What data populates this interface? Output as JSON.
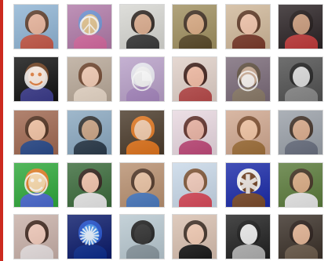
{
  "colors": {
    "accent_rule": "#cc2a1f"
  },
  "grid": {
    "rows": 5,
    "cols": 6,
    "avatars": [
      {
        "name": "avatar-woman-sunglasses-red",
        "bg": "#8fb4d4",
        "skin": "#e8b39a",
        "hair": "#5a3a28",
        "shirt": "#c65a4a",
        "icon": ""
      },
      {
        "name": "avatar-peace-sign-art",
        "bg": "#b07aa8",
        "skin": "#e0c08a",
        "hair": "#6a8fd0",
        "shirt": "#d46aa0",
        "icon": "☮"
      },
      {
        "name": "avatar-woman-sunglasses",
        "bg": "#d7d7d2",
        "skin": "#d9a98a",
        "hair": "#2a211c",
        "shirt": "#3a3a3a",
        "icon": ""
      },
      {
        "name": "avatar-smiling-man",
        "bg": "#a09060",
        "skin": "#d8a880",
        "hair": "#3b2a1c",
        "shirt": "#5a4a2a",
        "icon": ""
      },
      {
        "name": "avatar-smiling-girl",
        "bg": "#d0b89a",
        "skin": "#f0c2a8",
        "hair": "#5a3420",
        "shirt": "#7a3a2a",
        "icon": ""
      },
      {
        "name": "avatar-group-photo",
        "bg": "#2a2224",
        "skin": "#c89878",
        "hair": "#181010",
        "shirt": "#c03a3a",
        "icon": ""
      },
      {
        "name": "avatar-orange-robot-cartoon",
        "bg": "#111111",
        "skin": "#e07a3a",
        "hair": "#6a3a1a",
        "shirt": "#3a3a8a",
        "icon": "☻"
      },
      {
        "name": "avatar-woman-with-baby",
        "bg": "#b8a898",
        "skin": "#f0c8b0",
        "hair": "#6a4028",
        "shirt": "#e8d8c8",
        "icon": ""
      },
      {
        "name": "avatar-white-creature",
        "bg": "#b8a0c8",
        "skin": "#f4f4f4",
        "hair": "#e8e8f0",
        "shirt": "#a888c0",
        "icon": "◔"
      },
      {
        "name": "avatar-dark-hair-woman",
        "bg": "#e0d0c8",
        "skin": "#f0b8a0",
        "hair": "#3a1a14",
        "shirt": "#b84a4a",
        "icon": ""
      },
      {
        "name": "avatar-owl-close-up",
        "bg": "#7a6a78",
        "skin": "#c8a890",
        "hair": "#5a4a3a",
        "shirt": "#8a7a68",
        "icon": "◉"
      },
      {
        "name": "avatar-black-white-woman",
        "bg": "#505050",
        "skin": "#d8d8d8",
        "hair": "#1a1a1a",
        "shirt": "#888888",
        "icon": ""
      },
      {
        "name": "avatar-girl-lying-sideways",
        "bg": "#a06850",
        "skin": "#f0c0a0",
        "hair": "#4a2a18",
        "shirt": "#2a4a8a",
        "icon": ""
      },
      {
        "name": "avatar-man-by-lake",
        "bg": "#8aa8c0",
        "skin": "#c8a080",
        "hair": "#2a2a2a",
        "shirt": "#2a3a4a",
        "icon": ""
      },
      {
        "name": "avatar-orange-hood",
        "bg": "#4a3a2a",
        "skin": "#f0c8a8",
        "hair": "#e0741c",
        "shirt": "#e0741c",
        "icon": ""
      },
      {
        "name": "avatar-girl-selfie-pink",
        "bg": "#e8d8e0",
        "skin": "#e8b0a0",
        "hair": "#5a2a24",
        "shirt": "#c04a7a",
        "icon": ""
      },
      {
        "name": "avatar-smiling-brunette",
        "bg": "#d0a890",
        "skin": "#f0c2a0",
        "hair": "#7a4a2a",
        "shirt": "#a0703a",
        "icon": ""
      },
      {
        "name": "avatar-two-men",
        "bg": "#9aa0a8",
        "skin": "#d8a888",
        "hair": "#3a2a20",
        "shirt": "#6a7080",
        "icon": ""
      },
      {
        "name": "avatar-green-cartoon-girl",
        "bg": "#2ea83a",
        "skin": "#f8d8a8",
        "hair": "#e07a20",
        "shirt": "#4a6ad0",
        "icon": "☺"
      },
      {
        "name": "avatar-woman-green-background",
        "bg": "#3a6a3a",
        "skin": "#f0c0a8",
        "hair": "#2a1a14",
        "shirt": "#e8e8e8",
        "icon": ""
      },
      {
        "name": "avatar-child-on-stairs",
        "bg": "#b89070",
        "skin": "#e8c0a0",
        "hair": "#4a3020",
        "shirt": "#4a7ac0",
        "icon": ""
      },
      {
        "name": "avatar-girl-with-hat",
        "bg": "#c8d8e8",
        "skin": "#f0c8b8",
        "hair": "#7a5030",
        "shirt": "#d84a5a",
        "icon": ""
      },
      {
        "name": "avatar-pixel-character-blue",
        "bg": "#1a2aa8",
        "skin": "#6a3a1a",
        "hair": "#f0f0f0",
        "shirt": "#7a4a2a",
        "icon": "✱"
      },
      {
        "name": "avatar-man-sunglasses-green",
        "bg": "#5a7a3a",
        "skin": "#d8a880",
        "hair": "#3a2a1a",
        "shirt": "#e8e8e8",
        "icon": ""
      },
      {
        "name": "avatar-two-girls",
        "bg": "#c8b0a8",
        "skin": "#f0c8b8",
        "hair": "#3a2218",
        "shirt": "#e8e0e0",
        "icon": ""
      },
      {
        "name": "avatar-blue-spiral",
        "bg": "#0a1a6a",
        "skin": "#3a8ae8",
        "hair": "#1a4ac8",
        "shirt": "#0a2a8a",
        "icon": "✺"
      },
      {
        "name": "avatar-person-on-beach",
        "bg": "#b8c8d0",
        "skin": "#2a2a2a",
        "hair": "#1a1a1a",
        "shirt": "#8a98a0",
        "icon": ""
      },
      {
        "name": "avatar-big-sunglasses",
        "bg": "#d8c0b0",
        "skin": "#f0c8b0",
        "hair": "#3a2a20",
        "shirt": "#1a1a1a",
        "icon": ""
      },
      {
        "name": "avatar-black-white-hand",
        "bg": "#202020",
        "skin": "#e8e8e8",
        "hair": "#101010",
        "shirt": "#b0b0b0",
        "icon": ""
      },
      {
        "name": "avatar-couple-close-up",
        "bg": "#3a3028",
        "skin": "#e0b090",
        "hair": "#201410",
        "shirt": "#6a5a4a",
        "icon": ""
      }
    ]
  }
}
